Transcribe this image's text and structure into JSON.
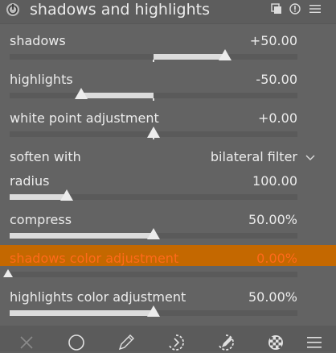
{
  "module": {
    "title": "shadows and highlights",
    "header_icons": [
      "multi-instance-icon",
      "reset-icon",
      "presets-menu-icon"
    ]
  },
  "sliders": {
    "shadows": {
      "label": "shadows",
      "value_text": "+50.00",
      "value": 50,
      "min": -100,
      "max": 100
    },
    "highlights": {
      "label": "highlights",
      "value_text": "-50.00",
      "value": -50,
      "min": -100,
      "max": 100
    },
    "white_point": {
      "label": "white point adjustment",
      "value_text": "+0.00",
      "value": 0,
      "min": -10,
      "max": 10
    },
    "radius": {
      "label": "radius",
      "value_text": "100.00",
      "value": 100,
      "min": 0,
      "max": 500
    },
    "compress": {
      "label": "compress",
      "value_text": "50.00%",
      "value": 50,
      "min": 0,
      "max": 100
    },
    "shadows_color": {
      "label": "shadows color adjustment",
      "value_text": "0.00%",
      "value": 0,
      "min": 0,
      "max": 100
    },
    "highlights_color": {
      "label": "highlights color adjustment",
      "value_text": "50.00%",
      "value": 50,
      "min": 0,
      "max": 100
    }
  },
  "soften_with": {
    "label": "soften with",
    "value": "bilateral filter"
  },
  "bottom_bar": {
    "icons": [
      "close-icon",
      "circle-mask-icon",
      "drawn-mask-icon",
      "parametric-mask-icon",
      "drawn-parametric-mask-icon",
      "raster-mask-icon",
      "menu-icon"
    ]
  },
  "colors": {
    "accent": "#c46800",
    "accent_text": "#ff6a1a",
    "panel": "#636363"
  }
}
